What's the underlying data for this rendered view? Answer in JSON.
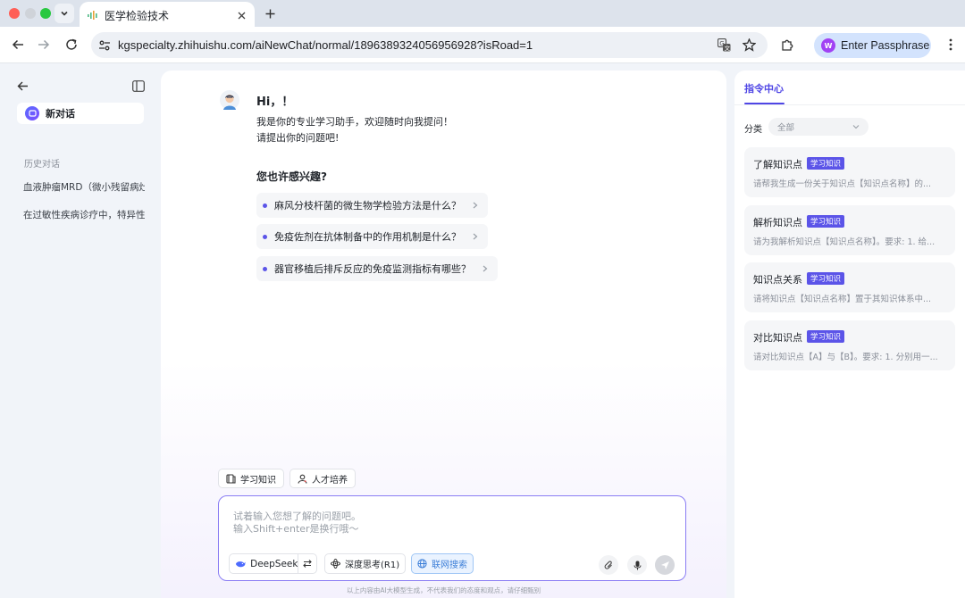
{
  "browser": {
    "tab_title": "医学检验技术",
    "url": "kgspecialty.zhihuishu.com/aiNewChat/normal/1896389324056956928?isRoad=1",
    "profile_label": "Enter Passphrase",
    "profile_initial": "W"
  },
  "sidebar": {
    "new_chat_label": "新对话",
    "history_title": "历史对话",
    "history": [
      "血液肿瘤MRD（微小残留病灶）",
      "在过敏性疾病诊疗中，特异性IgE"
    ]
  },
  "chat": {
    "greeting_title": "Hi，！",
    "greeting_lines": [
      "我是你的专业学习助手，欢迎随时向我提问！",
      "请提出你的问题吧!"
    ],
    "interest_title": "您也许感兴趣?",
    "suggestions": [
      "麻风分枝杆菌的微生物学检验方法是什么？",
      "免疫佐剂在抗体制备中的作用机制是什么？",
      "器官移植后排斥反应的免疫监测指标有哪些？"
    ],
    "chips": [
      "学习知识",
      "人才培养"
    ],
    "input_placeholder_lines": [
      "试着输入您想了解的问题吧。",
      "输入Shift+enter是换行哦～"
    ],
    "tools": {
      "model": "DeepSeek",
      "deep_think": "深度思考(R1)",
      "web_search": "联网搜索"
    },
    "disclaimer": "以上内容由AI大模型生成，不代表我们的态度和观点，请仔细甄别"
  },
  "right_panel": {
    "tab": "指令中心",
    "category_label": "分类",
    "category_value": "全部",
    "cards": [
      {
        "title": "了解知识点",
        "tag": "学习知识",
        "desc": "请帮我生成一份关于知识点【知识点名称】的..."
      },
      {
        "title": "解析知识点",
        "tag": "学习知识",
        "desc": "请为我解析知识点【知识点名称】。要求: 1. 给..."
      },
      {
        "title": "知识点关系",
        "tag": "学习知识",
        "desc": "请将知识点【知识点名称】置于其知识体系中..."
      },
      {
        "title": "对比知识点",
        "tag": "学习知识",
        "desc": "请对比知识点【A】与【B】。要求: 1. 分别用一..."
      }
    ]
  },
  "colors": {
    "accent": "#4f46e5",
    "tag_bg": "#5b54e8",
    "input_border": "#8a7df4"
  }
}
